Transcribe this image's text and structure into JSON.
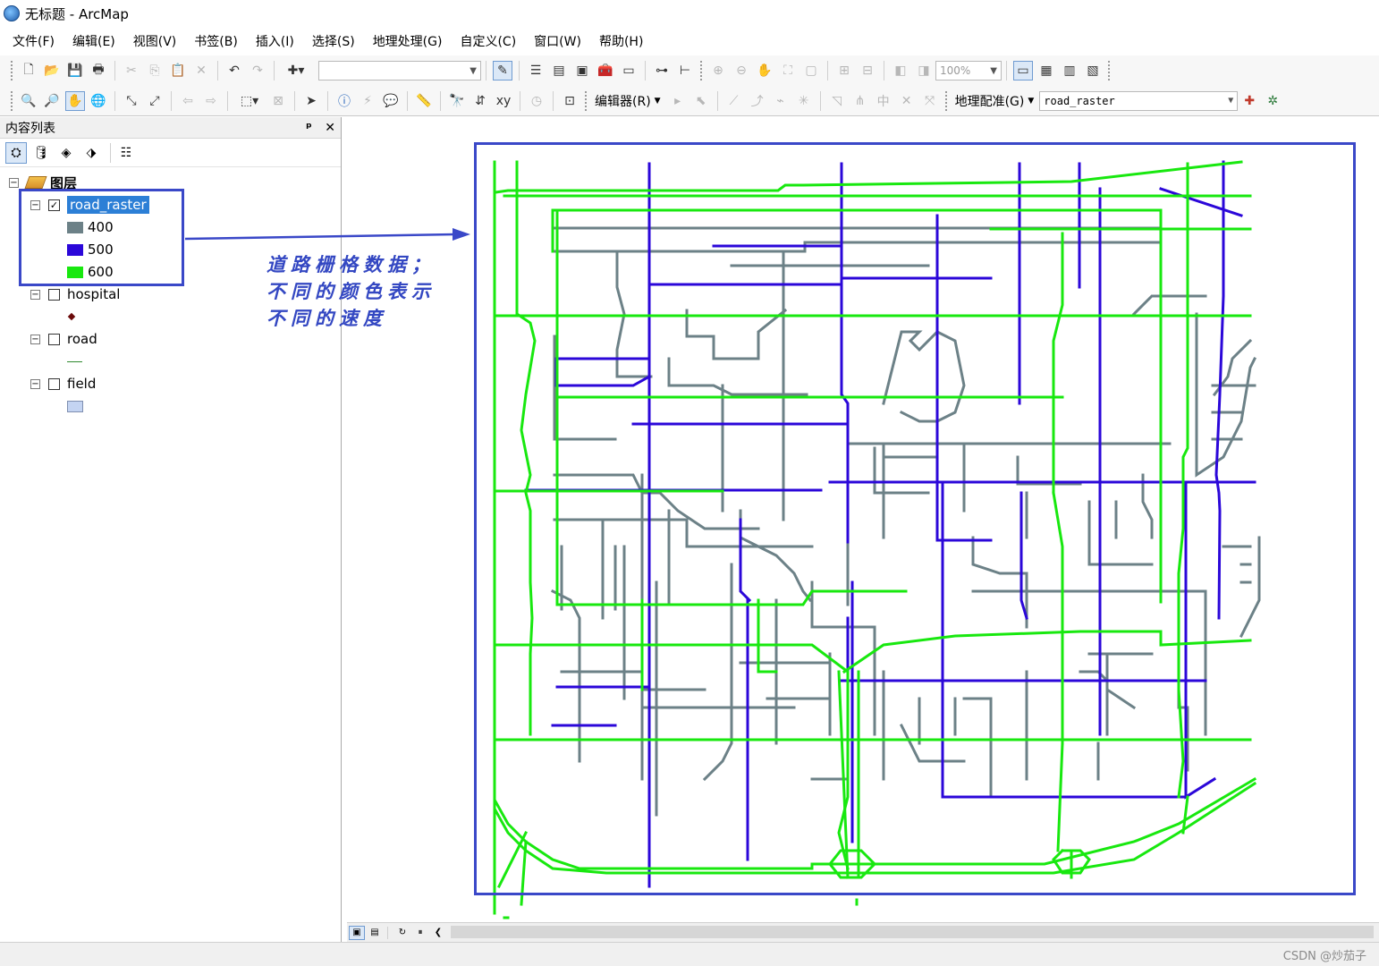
{
  "window": {
    "title": "无标题 - ArcMap"
  },
  "menu": [
    "文件(F)",
    "编辑(E)",
    "视图(V)",
    "书签(B)",
    "插入(I)",
    "选择(S)",
    "地理处理(G)",
    "自定义(C)",
    "窗口(W)",
    "帮助(H)"
  ],
  "toolbar": {
    "scale_value": "",
    "zoom_value": "100%",
    "editor_label": "编辑器(R)",
    "georef_label": "地理配准(G)",
    "georef_layer": "road_raster"
  },
  "toc": {
    "title": "内容列表",
    "pin_glyph": "ᵖ",
    "close_glyph": "✕",
    "root": "图层",
    "layers": [
      {
        "name": "road_raster",
        "checked": true,
        "legend": [
          {
            "label": "400",
            "color": "#6c8187"
          },
          {
            "label": "500",
            "color": "#2b07d9"
          },
          {
            "label": "600",
            "color": "#18e80f"
          }
        ]
      },
      {
        "name": "hospital",
        "checked": false,
        "legend_symbol": "point",
        "symbol_color": "#6b0a0a"
      },
      {
        "name": "road",
        "checked": false,
        "legend_symbol": "line",
        "symbol_color": "#2f8a2f"
      },
      {
        "name": "field",
        "checked": false,
        "legend_symbol": "polygon",
        "symbol_color": "#c4d4f2"
      }
    ]
  },
  "annotation": {
    "lines": [
      "道路栅格数据；",
      "不同的颜色表示",
      "不同的速度"
    ],
    "color": "#3347c2"
  },
  "colors": {
    "frame": "#3a48c8",
    "speed_400": "#6c8187",
    "speed_500": "#2b07d9",
    "speed_600": "#18e80f"
  },
  "watermark": "CSDN @炒茄子"
}
